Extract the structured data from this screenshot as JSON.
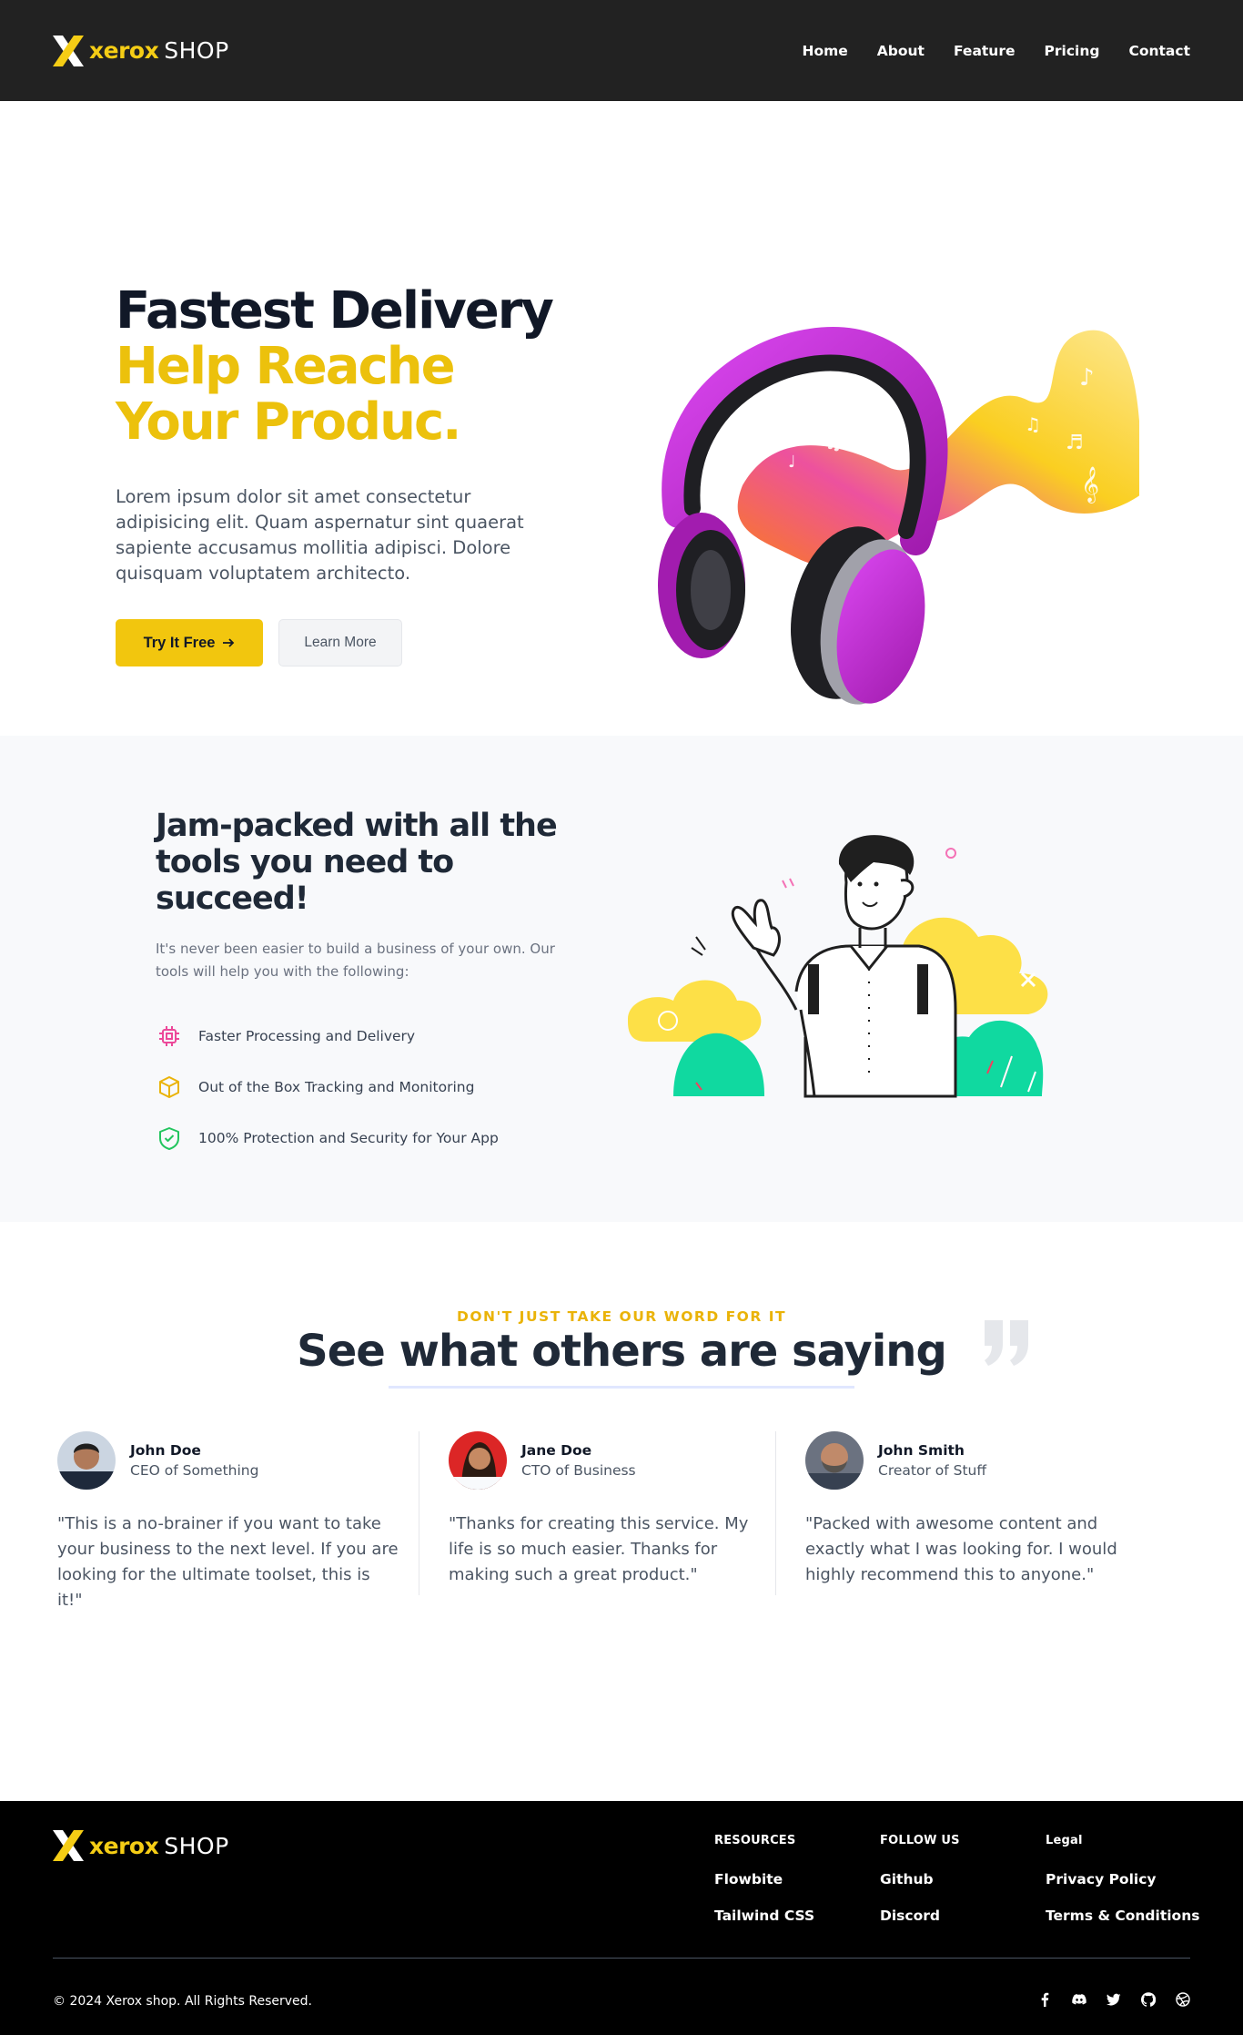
{
  "brand": {
    "name": "xerox",
    "suffix": "SHOP"
  },
  "nav": {
    "links": [
      "Home",
      "About",
      "Feature",
      "Pricing",
      "Contact"
    ]
  },
  "hero": {
    "title_line1": "Fastest Delivery",
    "title_line2": "Help Reache",
    "title_line3": "Your Produc.",
    "description": "Lorem ipsum dolor sit amet consectetur adipisicing elit. Quam aspernatur sint quaerat sapiente accusamus mollitia adipisci. Dolore quisquam voluptatem architecto.",
    "primary_button": "Try It Free",
    "secondary_button": "Learn More"
  },
  "features": {
    "title": "Jam-packed with all the tools you need to succeed!",
    "description": "It's never been easier to build a business of your own. Our tools will help you with the following:",
    "items": [
      {
        "icon": "chip-icon",
        "label": "Faster Processing and Delivery",
        "color": "#ec4899"
      },
      {
        "icon": "box-icon",
        "label": "Out of the Box Tracking and Monitoring",
        "color": "#eab308"
      },
      {
        "icon": "shield-check-icon",
        "label": "100% Protection and Security for Your App",
        "color": "#22c55e"
      }
    ]
  },
  "testimonials": {
    "eyebrow": "DON'T JUST TAKE OUR WORD FOR IT",
    "title": "See what others are saying",
    "items": [
      {
        "name": "John Doe",
        "role": "CEO of Something",
        "quote": "\"This is a no-brainer if you want to take your business to the next level. If you are looking for the ultimate toolset, this is it!\""
      },
      {
        "name": "Jane Doe",
        "role": "CTO of Business",
        "quote": "\"Thanks for creating this service. My life is so much easier. Thanks for making such a great product.\""
      },
      {
        "name": "John Smith",
        "role": "Creator of Stuff",
        "quote": "\"Packed with awesome content and exactly what I was looking for. I would highly recommend this to anyone.\""
      }
    ]
  },
  "footer": {
    "columns": [
      {
        "title": "RESOURCES",
        "links": [
          "Flowbite",
          "Tailwind CSS"
        ]
      },
      {
        "title": "FOLLOW US",
        "links": [
          "Github",
          "Discord"
        ]
      },
      {
        "title": "Legal",
        "links": [
          "Privacy Policy",
          "Terms & Conditions"
        ]
      }
    ],
    "copyright": "© 2024 Xerox shop. All Rights Reserved.",
    "socials": [
      "facebook-icon",
      "discord-icon",
      "twitter-icon",
      "github-icon",
      "dribbble-icon"
    ]
  },
  "colors": {
    "accent": "#f2c60e",
    "nav_bg": "#222222",
    "footer_bg": "#000000"
  }
}
